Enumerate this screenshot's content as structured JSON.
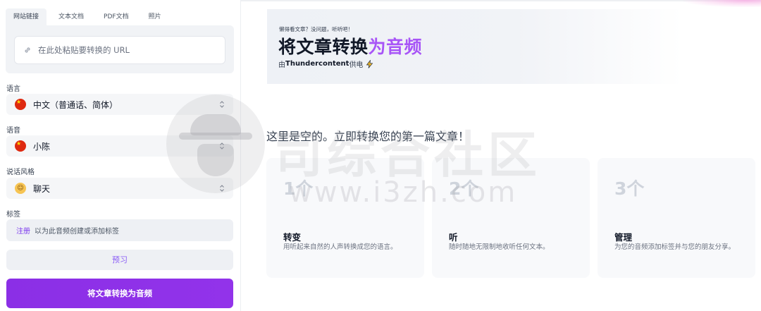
{
  "tabs": [
    {
      "label": "网站链接",
      "active": true
    },
    {
      "label": "文本文档",
      "active": false
    },
    {
      "label": "PDF文档",
      "active": false
    },
    {
      "label": "照片",
      "active": false
    }
  ],
  "url_input": {
    "placeholder": "在此处粘贴要转换的 URL",
    "icon": "link-icon"
  },
  "language": {
    "label": "语言",
    "value": "中文（普通话、简体）",
    "icon": "china-flag-icon"
  },
  "voice": {
    "label": "语音",
    "value": "小陈",
    "icon": "china-flag-icon"
  },
  "style": {
    "label": "说话风格",
    "value": "聊天",
    "icon": "grinning-face-icon"
  },
  "tags": {
    "label": "标签",
    "register_link": "注册",
    "hint": "以为此音频创建或添加标签"
  },
  "buttons": {
    "preview": "预习",
    "convert": "将文章转换为音频"
  },
  "hero": {
    "kicker": "懒得看文章？没问题，听听吧！",
    "title_main": "将文章转换",
    "title_highlight": "为音频",
    "powered_prefix": "由",
    "powered_brand": "Thundercontent",
    "powered_suffix": "供电"
  },
  "empty_message": "这里是空的。立即转换您的第一篇文章！",
  "cards": [
    {
      "num": "1个",
      "title": "转变",
      "desc": "用听起来自然的人声转换成您的语言。"
    },
    {
      "num": "2个",
      "title": "听",
      "desc": "随时随地无限制地收听任何文本。"
    },
    {
      "num": "3个",
      "title": "管理",
      "desc": "为您的音频添加标签并与您的朋友分享。"
    }
  ],
  "watermark": {
    "text": "司综合社区",
    "url": "www.i3zh.com"
  },
  "colors": {
    "accent": "#8b2fe6",
    "highlight": "#a855f7",
    "panel": "#f1f3f6"
  }
}
